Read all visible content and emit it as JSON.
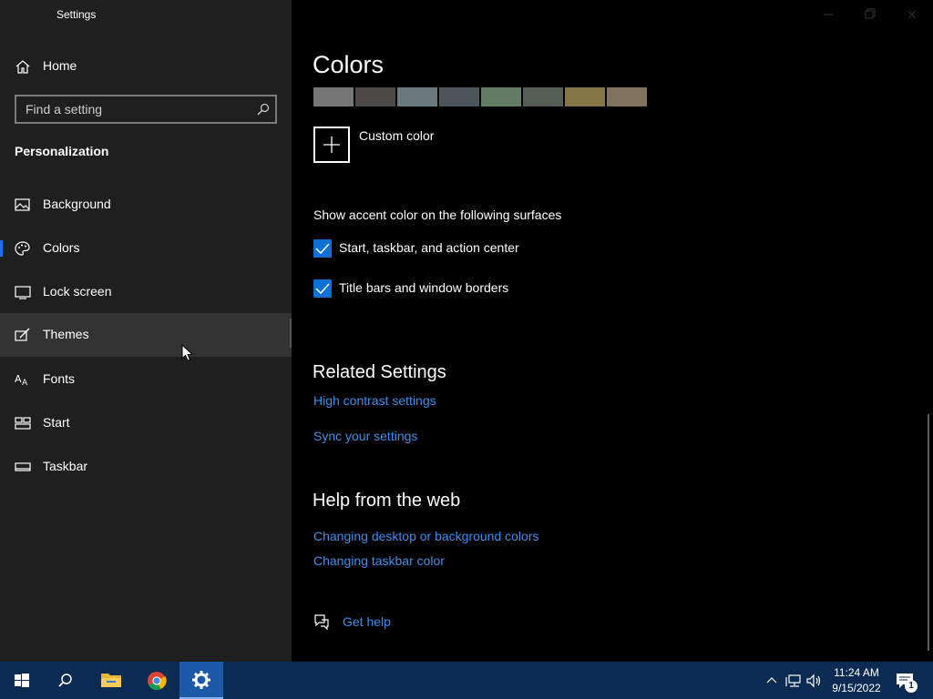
{
  "window": {
    "title": "Settings"
  },
  "sidebar": {
    "home_label": "Home",
    "search_placeholder": "Find a setting",
    "section_title": "Personalization",
    "items": [
      {
        "label": "Background",
        "icon": "picture-icon"
      },
      {
        "label": "Colors",
        "icon": "palette-icon",
        "selected": true
      },
      {
        "label": "Lock screen",
        "icon": "lock-screen-icon"
      },
      {
        "label": "Themes",
        "icon": "themes-icon",
        "hovered": true
      },
      {
        "label": "Fonts",
        "icon": "fonts-icon"
      },
      {
        "label": "Start",
        "icon": "start-icon"
      },
      {
        "label": "Taskbar",
        "icon": "taskbar-icon"
      }
    ]
  },
  "main": {
    "page_title": "Colors",
    "swatches": [
      "#767676",
      "#4c4a48",
      "#69797e",
      "#4a5459",
      "#647c64",
      "#525e54",
      "#847545",
      "#7e735f"
    ],
    "custom_color_label": "Custom color",
    "accent_heading": "Show accent color on the following surfaces",
    "checkboxes": [
      {
        "label": "Start, taskbar, and action center",
        "checked": true
      },
      {
        "label": "Title bars and window borders",
        "checked": true
      }
    ],
    "related_heading": "Related Settings",
    "related_links": [
      "High contrast settings",
      "Sync your settings"
    ],
    "help_heading": "Help from the web",
    "help_links": [
      "Changing desktop or background colors",
      "Changing taskbar color"
    ],
    "get_help_label": "Get help"
  },
  "taskbar": {
    "time": "11:24 AM",
    "date": "9/15/2022",
    "notification_count": "1",
    "accent": "#0b2b52"
  }
}
